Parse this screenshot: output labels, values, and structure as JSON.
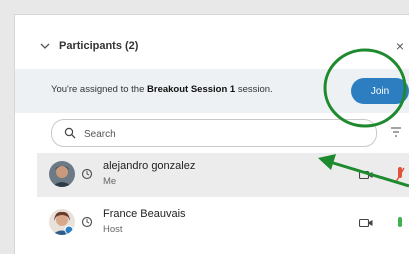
{
  "panel": {
    "title": "Participants (2)",
    "close_label": "×"
  },
  "assignment": {
    "prefix": "You're assigned to the ",
    "session_name": "Breakout Session 1",
    "suffix": " session.",
    "join_label": "Join"
  },
  "search": {
    "placeholder": "Search",
    "value": ""
  },
  "participants": [
    {
      "name": "alejandro gonzalez",
      "role": "Me"
    },
    {
      "name": "France Beauvais",
      "role": "Host"
    }
  ],
  "colors": {
    "accent": "#2d7ec1",
    "annotation": "#1e8a2e",
    "mic_muted": "#e0523a",
    "mic_active": "#3fb34f"
  },
  "icons": [
    "chevron-down-icon",
    "close-icon",
    "search-icon",
    "filter-icon",
    "presence-icon",
    "camera-icon",
    "microphone-icon"
  ]
}
